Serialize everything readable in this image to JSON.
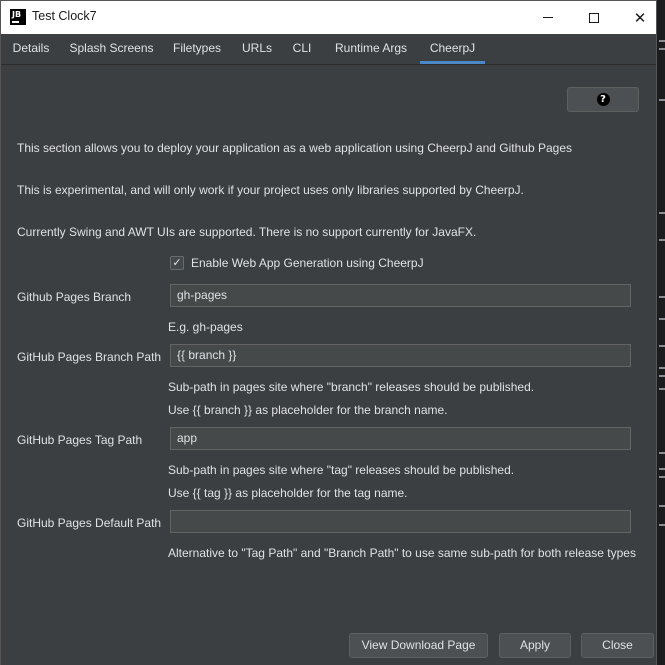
{
  "window": {
    "app_icon_text": "JB",
    "title": "Test Clock7",
    "close_glyph": "✕"
  },
  "tabs": [
    {
      "label": "Details"
    },
    {
      "label": "Splash Screens"
    },
    {
      "label": "Filetypes"
    },
    {
      "label": "URLs"
    },
    {
      "label": "CLI"
    },
    {
      "label": "Runtime Args"
    },
    {
      "label": "CheerpJ",
      "active": true
    }
  ],
  "help_button": {
    "glyph": "?"
  },
  "description": [
    "This section allows you to deploy your application as a web application using CheerpJ and Github Pages",
    "This is experimental, and will only work if your project uses only libraries supported by CheerpJ.",
    "Currently Swing and AWT UIs are supported. There is no support currently for JavaFX."
  ],
  "enable_checkbox": {
    "label": "Enable Web App Generation using CheerpJ",
    "checked": true,
    "glyph": "✓"
  },
  "fields": {
    "branch": {
      "label": "Github Pages Branch",
      "value": "gh-pages",
      "hints": [
        "E.g. gh-pages"
      ]
    },
    "branch_path": {
      "label": "GitHub Pages Branch Path",
      "value": "{{ branch }}",
      "hints": [
        "Sub-path in pages site where \"branch\" releases should be published.",
        "Use {{ branch }} as placeholder for the branch name."
      ]
    },
    "tag_path": {
      "label": "GitHub Pages Tag Path",
      "value": "app",
      "hints": [
        "Sub-path in pages site where \"tag\" releases should be published.",
        "Use {{ tag }} as placeholder for the tag name."
      ]
    },
    "default_path": {
      "label": "GitHub Pages Default Path",
      "value": "",
      "hints": [
        "Alternative to \"Tag Path\" and \"Branch Path\" to use same sub-path for both release types"
      ]
    }
  },
  "buttons": {
    "view_download": "View Download Page",
    "apply": "Apply",
    "close": "Close"
  },
  "colors": {
    "accent": "#4a88c7",
    "panel": "#3c3f41",
    "field": "#45494a"
  }
}
